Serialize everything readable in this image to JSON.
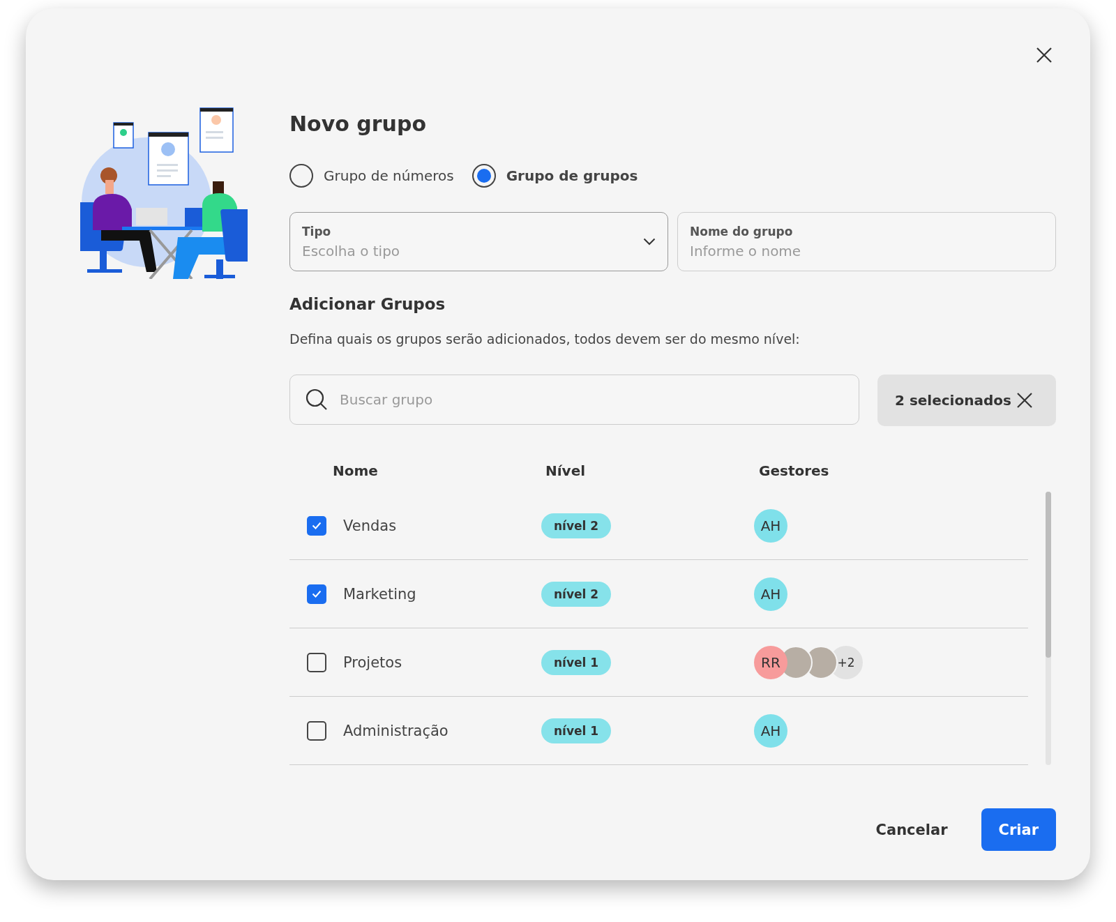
{
  "dialog": {
    "title": "Novo grupo"
  },
  "radios": [
    {
      "label": "Grupo de números",
      "selected": false
    },
    {
      "label": "Grupo de grupos",
      "selected": true
    }
  ],
  "fields": [
    {
      "kind": "select",
      "label": "Tipo",
      "placeholder": "Escolha o tipo"
    },
    {
      "kind": "text",
      "label": "Nome do grupo",
      "placeholder": "Informe o nome"
    }
  ],
  "section": {
    "title": "Adicionar Grupos",
    "description": "Defina quais os grupos serão adicionados, todos devem ser do mesmo nível:"
  },
  "search": {
    "placeholder": "Buscar grupo"
  },
  "selection_chip": {
    "label": "2 selecionados"
  },
  "table": {
    "columns": [
      "Nome",
      "Nível",
      "Gestores"
    ],
    "rows": [
      {
        "checked": true,
        "name": "Vendas",
        "level": "nível 2",
        "managers": [
          {
            "kind": "initials",
            "text": "AH",
            "color": "#7fe0ea"
          }
        ]
      },
      {
        "checked": true,
        "name": "Marketing",
        "level": "nível 2",
        "managers": [
          {
            "kind": "initials",
            "text": "AH",
            "color": "#7fe0ea"
          }
        ]
      },
      {
        "checked": false,
        "name": "Projetos",
        "level": "nível 1",
        "managers": [
          {
            "kind": "initials",
            "text": "RR",
            "color": "#f79b9b"
          },
          {
            "kind": "photo"
          },
          {
            "kind": "photo"
          },
          {
            "kind": "more",
            "text": "+2"
          }
        ]
      },
      {
        "checked": false,
        "name": "Administração",
        "level": "nível 1",
        "managers": [
          {
            "kind": "initials",
            "text": "AH",
            "color": "#7fe0ea"
          }
        ]
      }
    ]
  },
  "buttons": [
    {
      "kind": "text",
      "label": "Cancelar"
    },
    {
      "kind": "primary",
      "label": "Criar"
    }
  ]
}
